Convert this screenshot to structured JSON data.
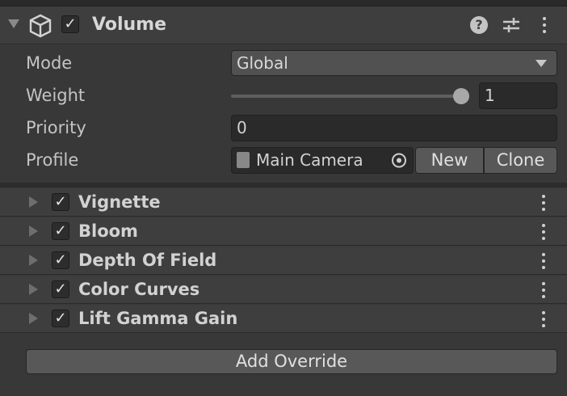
{
  "component": {
    "title": "Volume",
    "enabled_mark": "✓",
    "icons": [
      "cube-icon",
      "help-icon",
      "preset-sliders-icon",
      "kebab-menu-icon"
    ]
  },
  "fields": {
    "mode": {
      "label": "Mode",
      "value": "Global"
    },
    "weight": {
      "label": "Weight",
      "value": "1",
      "slider_fraction": 1.0
    },
    "priority": {
      "label": "Priority",
      "value": "0"
    },
    "profile": {
      "label": "Profile",
      "value": "Main Camera",
      "new_label": "New",
      "clone_label": "Clone"
    }
  },
  "overrides": [
    {
      "name": "Vignette",
      "enabled": true
    },
    {
      "name": "Bloom",
      "enabled": true
    },
    {
      "name": "Depth Of Field",
      "enabled": true
    },
    {
      "name": "Color Curves",
      "enabled": true
    },
    {
      "name": "Lift Gamma Gain",
      "enabled": true
    }
  ],
  "check_mark": "✓",
  "add_override_label": "Add Override"
}
